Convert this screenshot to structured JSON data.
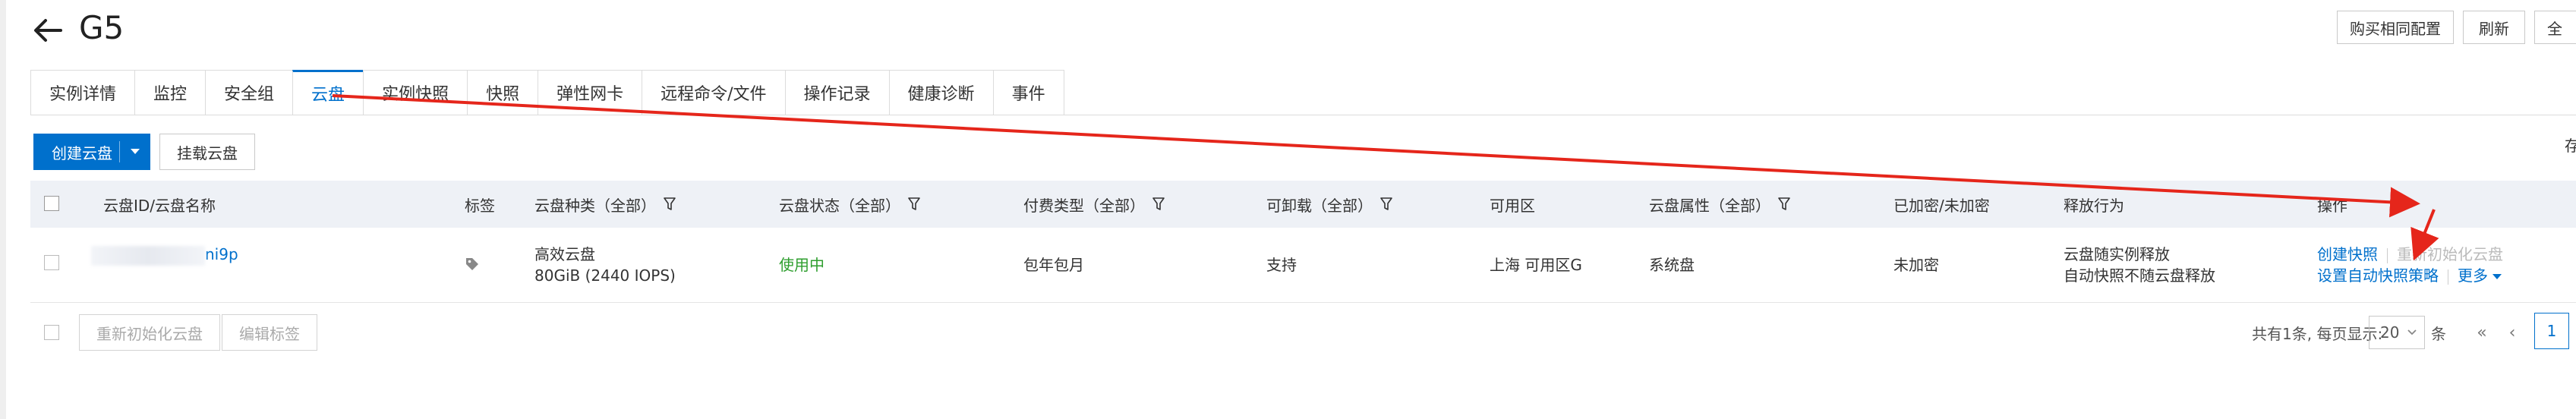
{
  "header": {
    "title": "G5",
    "buttons": [
      "购买相同配置",
      "刷新",
      "全"
    ]
  },
  "tabs": [
    {
      "label": "实例详情",
      "active": false
    },
    {
      "label": "监控",
      "active": false
    },
    {
      "label": "安全组",
      "active": false
    },
    {
      "label": "云盘",
      "active": true
    },
    {
      "label": "实例快照",
      "active": false
    },
    {
      "label": "快照",
      "active": false
    },
    {
      "label": "弹性网卡",
      "active": false
    },
    {
      "label": "远程命令/文件",
      "active": false
    },
    {
      "label": "操作记录",
      "active": false
    },
    {
      "label": "健康诊断",
      "active": false
    },
    {
      "label": "事件",
      "active": false
    }
  ],
  "toolbar": {
    "create_disk": "创建云盘",
    "attach_disk": "挂载云盘",
    "right_cut": "存"
  },
  "table": {
    "columns": {
      "id": "云盘ID/云盘名称",
      "tag": "标签",
      "type": "云盘种类（全部）",
      "status": "云盘状态（全部）",
      "billing": "付费类型（全部）",
      "detachable": "可卸载（全部）",
      "zone": "可用区",
      "attr": "云盘属性（全部）",
      "encrypt": "已加密/未加密",
      "release": "释放行为",
      "ops": "操作"
    },
    "rows": [
      {
        "id_suffix": "ni9p",
        "type": "高效云盘",
        "size": "80GiB (2440 IOPS)",
        "status": "使用中",
        "billing": "包年包月",
        "detachable": "支持",
        "zone": "上海 可用区G",
        "attr": "系统盘",
        "encrypt": "未加密",
        "release_1": "云盘随实例释放",
        "release_2": "自动快照不随云盘释放",
        "op_snapshot": "创建快照",
        "op_reinit": "重新初始化云盘",
        "op_auto_policy": "设置自动快照策略",
        "op_more": "更多"
      }
    ]
  },
  "footer": {
    "reinit": "重新初始化云盘",
    "edit_tags": "编辑标签",
    "summary": "共有1条, 每页显示:",
    "page_size": "20",
    "unit": "条",
    "first": "«",
    "prev": "‹",
    "current_page": "1"
  },
  "colors": {
    "primary": "#0070cc",
    "success": "#2e9e2e",
    "header_bg": "#eef1f6",
    "annotation": "#e5261b"
  }
}
